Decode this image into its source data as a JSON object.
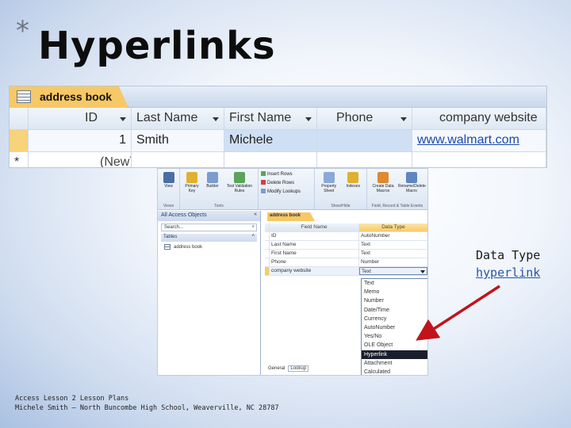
{
  "slide": {
    "bullet": "*",
    "title": "Hyperlinks",
    "note_line1": "Data Type",
    "note_line2": "hyperlink",
    "footer_line1": "Access Lesson 2 Lesson Plans",
    "footer_line2": "Michele Smith – North Buncombe High School, Weaverville, NC 28787"
  },
  "address_table": {
    "tab_label": "address book",
    "columns": [
      "ID",
      "Last Name",
      "First Name",
      "Phone",
      "company website"
    ],
    "row": {
      "id": "1",
      "last_name": "Smith",
      "first_name": "Michele",
      "phone": "",
      "website": "www.walmart.com"
    },
    "new_row": {
      "marker": "*",
      "id": "(New)"
    }
  },
  "design_view": {
    "ribbon": {
      "view_label": "View",
      "primary_key_label": "Primary Key",
      "builder_label": "Builder",
      "test_validation_label": "Test Validation Rules",
      "insert_rows": "Insert Rows",
      "delete_rows": "Delete Rows",
      "modify_lookups": "Modify Lookups",
      "property_sheet": "Property Sheet",
      "indexes": "Indexes",
      "create_data_macros": "Create Data Macros",
      "rename_delete_macro": "Rename/Delete Macro",
      "group_views": "Views",
      "group_tools": "Tools",
      "group_show_hide": "Show/Hide",
      "group_field_events": "Field, Record & Table Events"
    },
    "nav_pane": {
      "title": "All Access Objects",
      "search_placeholder": "Search...",
      "section": "Tables",
      "item": "address book"
    },
    "tab_label": "address book",
    "headers": {
      "field_name": "Field Name",
      "data_type": "Data Type"
    },
    "fields": [
      {
        "name": "ID",
        "type": "AutoNumber"
      },
      {
        "name": "Last Name",
        "type": "Text"
      },
      {
        "name": "First Name",
        "type": "Text"
      },
      {
        "name": "Phone",
        "type": "Number"
      },
      {
        "name": "company website",
        "type": "Text"
      }
    ],
    "dropdown_options": [
      "Text",
      "Memo",
      "Number",
      "Date/Time",
      "Currency",
      "AutoNumber",
      "Yes/No",
      "OLE Object",
      "Hyperlink",
      "Attachment",
      "Calculated"
    ],
    "dropdown_selected": "Hyperlink",
    "general_label": "General",
    "lookup_label": "Lookup"
  },
  "colors": {
    "accent_tab": "#f7c866",
    "arrow": "#c0141a",
    "link": "#1a4aa8"
  }
}
